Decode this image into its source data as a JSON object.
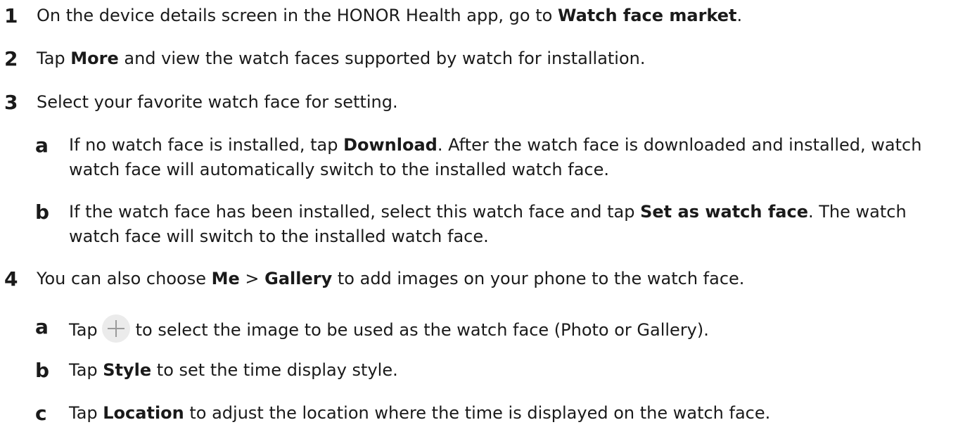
{
  "steps": [
    {
      "num": "1",
      "pre": "On the device details screen in the HONOR Health app, go to ",
      "bold": "Watch face market",
      "post": "."
    },
    {
      "num": "2",
      "pre": "Tap ",
      "bold": "More",
      "post": " and view the watch faces supported by watch for installation."
    },
    {
      "num": "3",
      "text": "Select your favorite watch face for setting.",
      "subs": [
        {
          "letter": "a",
          "pre": "If no watch face is installed, tap ",
          "bold": "Download",
          "post": ". After the watch face is downloaded and installed, watch watch face will automatically switch to the installed watch face."
        },
        {
          "letter": "b",
          "pre": "If the watch face has been installed, select this watch face and tap ",
          "bold": "Set as watch face",
          "post": ". The watch watch face will switch to the installed watch face."
        }
      ]
    },
    {
      "num": "4",
      "pre": "You can also choose ",
      "bold1": "Me",
      "mid": " > ",
      "bold2": "Gallery",
      "post": " to add images on your phone to the watch face.",
      "subs": [
        {
          "letter": "a",
          "pre": "Tap",
          "icon": "plus-icon",
          "post": "to select the image to be used as the watch face (Photo or Gallery)."
        },
        {
          "letter": "b",
          "pre": "Tap ",
          "bold": "Style",
          "post": " to set the time display style."
        },
        {
          "letter": "c",
          "pre": "Tap ",
          "bold": "Location",
          "post": " to adjust the location where the time is displayed on the watch face."
        }
      ]
    }
  ]
}
